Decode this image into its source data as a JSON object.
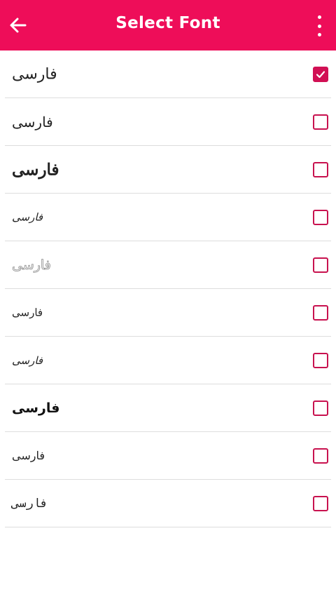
{
  "header": {
    "title": "Select Font",
    "back_icon": "arrow-left-icon",
    "menu_icon": "more-vert-icon",
    "background": "#ee0d59"
  },
  "fonts": [
    {
      "sample": "فارسی",
      "checked": true
    },
    {
      "sample": "فارسی",
      "checked": false
    },
    {
      "sample": "فارسی",
      "checked": false
    },
    {
      "sample": "فارسی",
      "checked": false
    },
    {
      "sample": "فارسی",
      "checked": false
    },
    {
      "sample": "فارسی",
      "checked": false
    },
    {
      "sample": "فارسی",
      "checked": false
    },
    {
      "sample": "فارسی",
      "checked": false
    },
    {
      "sample": "فارسی",
      "checked": false
    },
    {
      "sample": "فارسی",
      "checked": false
    }
  ],
  "colors": {
    "accent": "#ee0d59",
    "checkbox": "#c8124f",
    "divider": "#dddddd"
  }
}
